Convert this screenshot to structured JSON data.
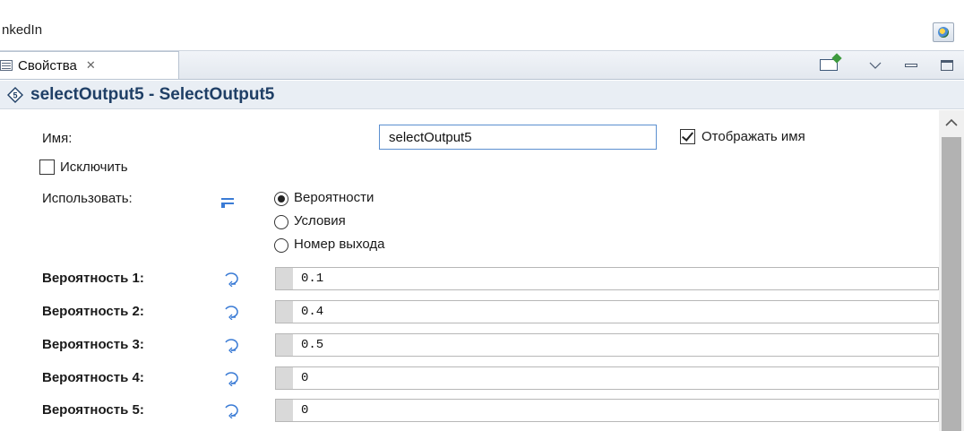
{
  "window": {
    "title": "nkedIn"
  },
  "tabs": {
    "properties_label": "Свойства",
    "close_glyph": "✕"
  },
  "header": {
    "title": "selectOutput5 - SelectOutput5"
  },
  "form": {
    "name_label": "Имя:",
    "name_value": "selectOutput5",
    "show_name_label": "Отображать имя",
    "show_name_checked": true,
    "exclude_label": "Исключить",
    "exclude_checked": false,
    "use_label": "Использовать:",
    "use_options": [
      {
        "label": "Вероятности",
        "selected": true
      },
      {
        "label": "Условия",
        "selected": false
      },
      {
        "label": "Номер выхода",
        "selected": false
      }
    ],
    "probabilities": [
      {
        "label": "Вероятность 1:",
        "value": "0.1"
      },
      {
        "label": "Вероятность 2:",
        "value": "0.4"
      },
      {
        "label": "Вероятность 3:",
        "value": "0.5"
      },
      {
        "label": "Вероятность 4:",
        "value": "0"
      },
      {
        "label": "Вероятность 5:",
        "value": "0"
      }
    ]
  },
  "icons": {
    "tab": "properties-icon",
    "header": "selectoutput-icon",
    "use": "static-value-icon",
    "probability": "dynamic-value-icon"
  },
  "colors": {
    "header_text": "#1f3f66",
    "accent_blue": "#3a7bd5",
    "scroll_thumb": "#b2b2b2"
  }
}
